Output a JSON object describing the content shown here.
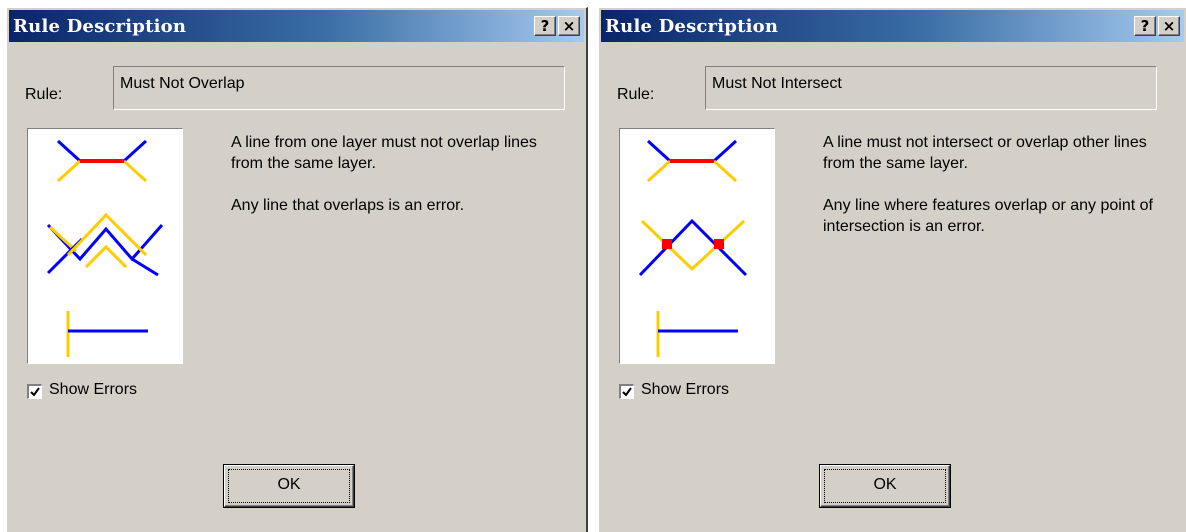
{
  "colors": {
    "title_gradient_start": "#0a246a",
    "title_gradient_end": "#a6caf0",
    "dialog_face": "#d4d0c8",
    "line_blue": "#0000ff",
    "line_yellow": "#ffcc00",
    "error_red": "#ff0000"
  },
  "dialogs": [
    {
      "title": "Rule Description",
      "help_button": "?",
      "close_button": "×",
      "rule_label": "Rule:",
      "rule_value": "Must Not Overlap",
      "description": [
        "A line from one layer must not overlap lines from the same layer.",
        "Any line that overlaps is an error."
      ],
      "diagram_icon": "must-not-overlap-diagram",
      "show_errors_label": "Show Errors",
      "show_errors_checked": true,
      "ok_label": "OK"
    },
    {
      "title": "Rule Description",
      "help_button": "?",
      "close_button": "×",
      "rule_label": "Rule:",
      "rule_value": "Must Not Intersect",
      "description": [
        "A line must not intersect or overlap other lines from the same layer.",
        "Any line where features overlap or any point of intersection is an error."
      ],
      "diagram_icon": "must-not-intersect-diagram",
      "show_errors_label": "Show Errors",
      "show_errors_checked": true,
      "ok_label": "OK"
    }
  ]
}
